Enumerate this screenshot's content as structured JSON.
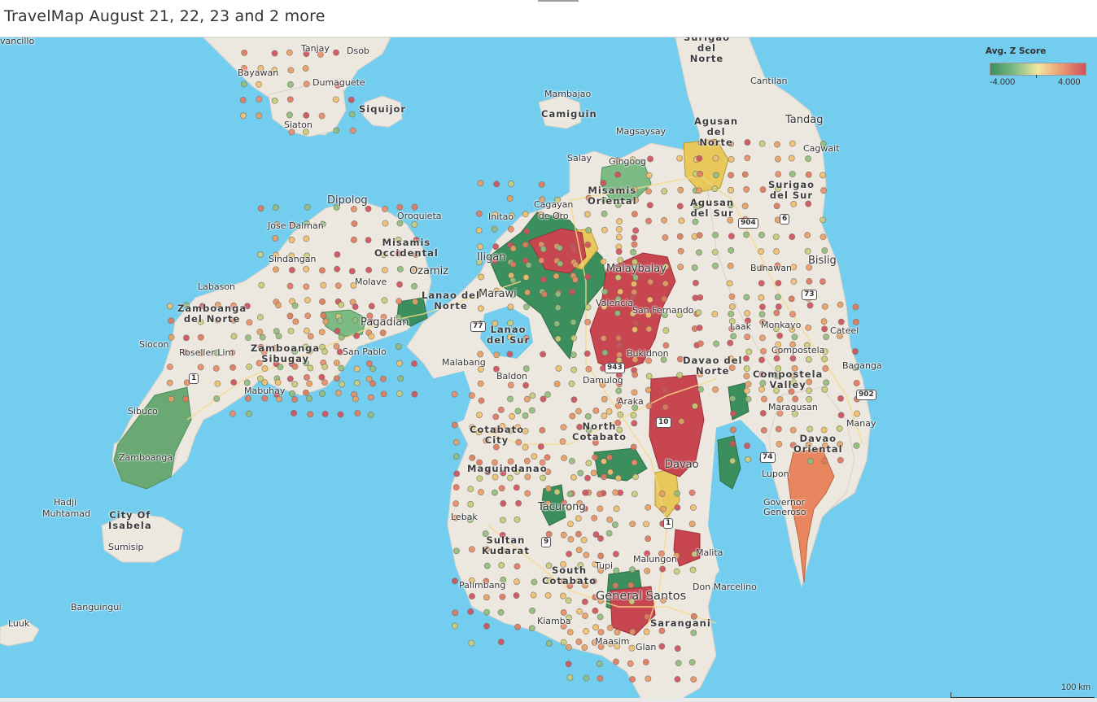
{
  "title": "TravelMap  August 21, 22, 23 and 2 more",
  "legend": {
    "title": "Avg. Z Score",
    "min_label": "-4.000",
    "max_label": "4.000",
    "colors": [
      "#3a8f5c",
      "#7dbb85",
      "#f2e7a0",
      "#e89a72",
      "#d0515e"
    ]
  },
  "scale_label": "100 km",
  "colors": {
    "water": "#73cdef",
    "land": "#ece7df",
    "low": "#3a8f5c",
    "mid_low": "#7dbb85",
    "mid": "#e8c85a",
    "mid_high": "#e89a72",
    "high": "#c8464f"
  },
  "places": [
    {
      "text": "Tanjay"
    },
    {
      "text": "Dsob"
    },
    {
      "text": "Bayawan"
    },
    {
      "text": "Dumaguete"
    },
    {
      "text": "Siquijor"
    },
    {
      "text": "Siaton"
    },
    {
      "text": "Mambajao"
    },
    {
      "text": "Camiguin"
    },
    {
      "text": "Magsaysay"
    },
    {
      "text": "Salay"
    },
    {
      "text": "Gingoog"
    },
    {
      "text": "Cantilan"
    },
    {
      "text": "Tandag"
    },
    {
      "text": "Cagwait"
    },
    {
      "text": "Dipolog"
    },
    {
      "text": "Oroquieta"
    },
    {
      "text": "Jose Dalman"
    },
    {
      "text": "Sindangan"
    },
    {
      "text": "Ozamiz"
    },
    {
      "text": "Molave"
    },
    {
      "text": "Labason"
    },
    {
      "text": "Iligan"
    },
    {
      "text": "Marawi"
    },
    {
      "text": "Malaybalay"
    },
    {
      "text": "Initao"
    },
    {
      "text": "San Fernando"
    },
    {
      "text": "Bunawan"
    },
    {
      "text": "Bislig"
    },
    {
      "text": "Laak"
    },
    {
      "text": "Monkayo"
    },
    {
      "text": "Cateel"
    },
    {
      "text": "Compostela"
    },
    {
      "text": "Siocon"
    },
    {
      "text": "Roseller Lim"
    },
    {
      "text": "San Pablo"
    },
    {
      "text": "Malabang"
    },
    {
      "text": "Baldon"
    },
    {
      "text": "Damulog"
    },
    {
      "text": "Baganga"
    },
    {
      "text": "Mabuhay"
    },
    {
      "text": "Araka"
    },
    {
      "text": "Maragusan"
    },
    {
      "text": "Sibuco"
    },
    {
      "text": "Manay"
    },
    {
      "text": "Hadji"
    },
    {
      "text": "Muhtamad"
    },
    {
      "text": "Sumisip"
    },
    {
      "text": "Lebak"
    },
    {
      "text": "Tacurong"
    },
    {
      "text": "Governor Generoso"
    },
    {
      "text": "Malita"
    },
    {
      "text": "Malungon"
    },
    {
      "text": "Tupi"
    },
    {
      "text": "Palimbang"
    },
    {
      "text": "Don Marcelino"
    },
    {
      "text": "Banguingui"
    },
    {
      "text": "Kiamba"
    },
    {
      "text": "Maasim"
    },
    {
      "text": "Glan"
    },
    {
      "text": "Luuk"
    },
    {
      "text": "vancillo"
    },
    {
      "text": "Lupon"
    }
  ],
  "provinces": [
    {
      "text": "Surigao\ndel\nNorte"
    },
    {
      "text": "Agusan\ndel\nNorte"
    },
    {
      "text": "Misamis\nOriental"
    },
    {
      "text": "Cagayan\nde Oro"
    },
    {
      "text": "Agusan\ndel Sur"
    },
    {
      "text": "Surigao\ndel Sur"
    },
    {
      "text": "Misamis\nOccidental"
    },
    {
      "text": "Lanao del\nNorte"
    },
    {
      "text": "Zamboanga\ndel Norte"
    },
    {
      "text": "Lanao\ndel Sur"
    },
    {
      "text": "Zamboanga\nSibugay"
    },
    {
      "text": "Davao del\nNorte"
    },
    {
      "text": "Compostela\nValley"
    },
    {
      "text": "North\nCotabato"
    },
    {
      "text": "Cotabato\nCity"
    },
    {
      "text": "Maguindanao"
    },
    {
      "text": "Davao\nOriental"
    },
    {
      "text": "City Of\nIsabela"
    },
    {
      "text": "Sultan\nKudarat"
    },
    {
      "text": "South\nCotabato"
    },
    {
      "text": "Sarangani"
    },
    {
      "text": "Zamboanga"
    },
    {
      "text": "Davao"
    },
    {
      "text": "Bukidnon"
    },
    {
      "text": "Valencia"
    },
    {
      "text": "Pagadian"
    }
  ],
  "cities": [
    {
      "text": "General Santos"
    }
  ],
  "shields": [
    {
      "text": "904"
    },
    {
      "text": "6"
    },
    {
      "text": "73"
    },
    {
      "text": "77"
    },
    {
      "text": "943"
    },
    {
      "text": "1"
    },
    {
      "text": "902"
    },
    {
      "text": "10"
    },
    {
      "text": "74"
    },
    {
      "text": "9"
    }
  ]
}
